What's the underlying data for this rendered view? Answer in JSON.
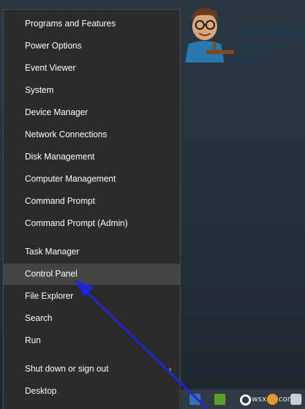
{
  "watermark": {
    "brand": "APPUALS",
    "tagline": "TECH HOW-TO'S FROM THE EXPERTS!",
    "corner": "wsxdn.com"
  },
  "menu": {
    "items": [
      {
        "label": "Programs and Features"
      },
      {
        "label": "Power Options"
      },
      {
        "label": "Event Viewer"
      },
      {
        "label": "System"
      },
      {
        "label": "Device Manager"
      },
      {
        "label": "Network Connections"
      },
      {
        "label": "Disk Management"
      },
      {
        "label": "Computer Management"
      },
      {
        "label": "Command Prompt"
      },
      {
        "label": "Command Prompt (Admin)"
      },
      {
        "label": "Task Manager"
      },
      {
        "label": "Control Panel",
        "active": true
      },
      {
        "label": "File Explorer"
      },
      {
        "label": "Search"
      },
      {
        "label": "Run"
      },
      {
        "label": "Shut down or sign out",
        "has_submenu": true
      },
      {
        "label": "Desktop"
      }
    ]
  },
  "annotation": {
    "arrow_color": "#1f27d6"
  },
  "colors": {
    "menu_bg": "#2b2b2b",
    "highlight": "#444444",
    "text": "#ffffff"
  },
  "icons": [
    "submenu-chevron-icon",
    "windows-store-icon",
    "rss-icon",
    "opera-icon",
    "user-icon",
    "network-icon"
  ]
}
